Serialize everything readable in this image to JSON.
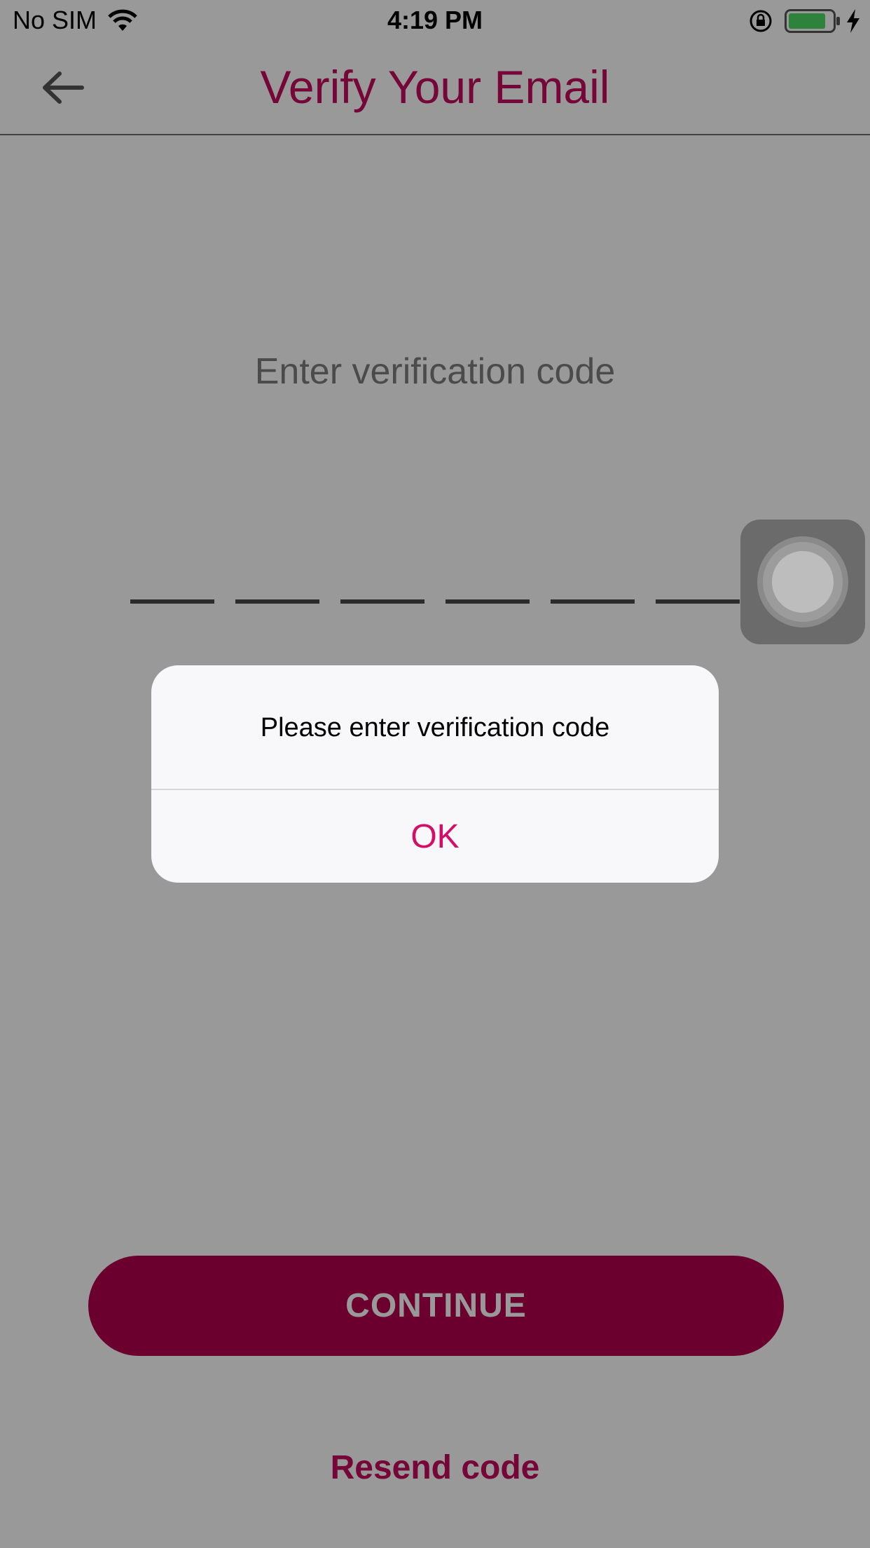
{
  "status_bar": {
    "carrier": "No SIM",
    "time": "4:19 PM",
    "battery_color": "#4cd964"
  },
  "nav": {
    "title": "Verify Your Email",
    "back_icon": "arrow-left-icon",
    "title_color": "#c40a5c"
  },
  "content": {
    "prompt": "Enter verification code",
    "code_slots": 6,
    "code_value": ""
  },
  "buttons": {
    "continue_label": "CONTINUE",
    "continue_color": "#b3004e",
    "resend_label": "Resend code"
  },
  "alert": {
    "message": "Please enter verification code",
    "ok_label": "OK",
    "ok_color": "#d40e66"
  },
  "icons": {
    "wifi": "wifi-icon",
    "rotation_lock": "rotation-lock-icon",
    "battery": "battery-icon",
    "charging": "charging-bolt-icon",
    "assistive_touch": "assistive-touch-icon"
  }
}
